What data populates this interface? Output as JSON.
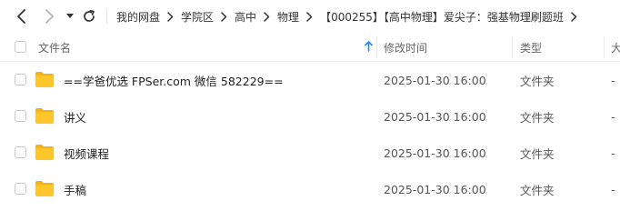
{
  "toolbar": {
    "icons": [
      "back-icon",
      "forward-icon",
      "dropdown-icon",
      "refresh-icon"
    ]
  },
  "breadcrumb": [
    "我的网盘",
    "学院区",
    "高中",
    "物理",
    "【000255】【高中物理】爱尖子：强基物理刷题班"
  ],
  "table": {
    "columns": {
      "name": "文件名",
      "modified": "修改时间",
      "type": "类型",
      "size": "大"
    },
    "sort": {
      "column": "name",
      "direction": "ascending",
      "icon": "sort-up-arrow-icon",
      "color": "#1e88ff"
    },
    "rows": [
      {
        "name": "==学爸优选 FPSer.com 微信 582229==",
        "modified": "2025-01-30 16:00",
        "type": "文件夹",
        "size": "-"
      },
      {
        "name": "讲义",
        "modified": "2025-01-30 16:00",
        "type": "文件夹",
        "size": "-"
      },
      {
        "name": "视频课程",
        "modified": "2025-01-30 16:00",
        "type": "文件夹",
        "size": "-"
      },
      {
        "name": "手稿",
        "modified": "2025-01-30 16:00",
        "type": "文件夹",
        "size": "-"
      }
    ]
  },
  "colors": {
    "folder": "#ffc62b",
    "folder_back": "#f5b415",
    "sort_arrow": "#1e88ff"
  }
}
